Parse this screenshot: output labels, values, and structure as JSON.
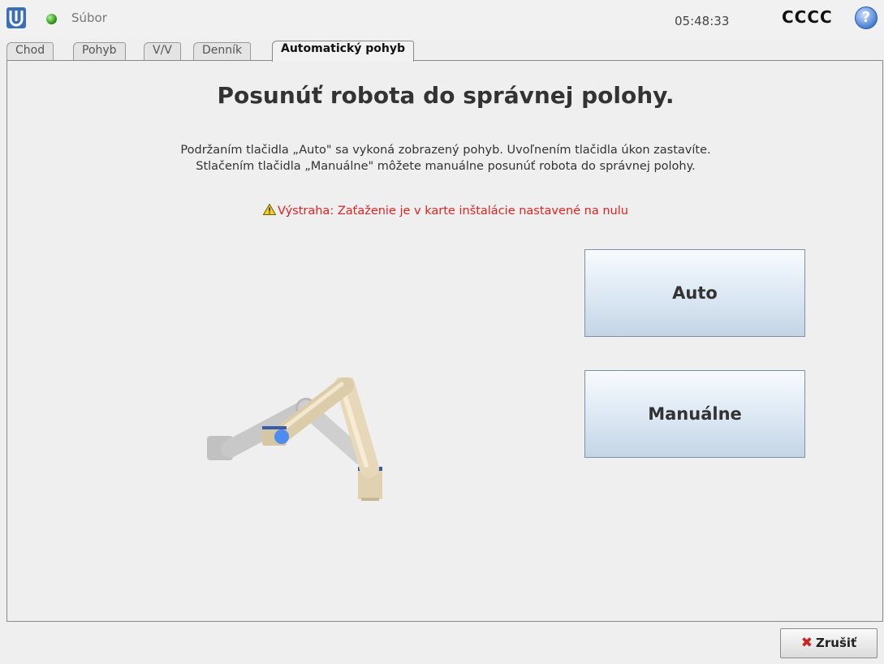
{
  "header": {
    "logo_icon": "ur-logo-icon",
    "status_icon": "robot-status-green-icon",
    "file_menu": "Súbor",
    "clock": "05:48:33",
    "robot_name": "CCCC",
    "help_label": "?"
  },
  "tabs": [
    {
      "label": "Chod"
    },
    {
      "label": "Pohyb"
    },
    {
      "label": "V/V"
    },
    {
      "label": "Denník"
    },
    {
      "label": "Automatický pohyb",
      "active": true
    }
  ],
  "main": {
    "title": "Posunúť robota do správnej polohy.",
    "instruction_1": "Podržaním tlačidla „Auto\" sa vykoná zobrazený pohyb. Uvoľnením tlačidla úkon zastavíte.",
    "instruction_2": "Stlačením tlačidla „Manuálne\" môžete manuálne posunúť robota do správnej polohy.",
    "warning": "Výstraha: Zaťaženie je v karte inštalácie nastavené na nulu",
    "warning_color": "#e42222",
    "auto_button": "Auto",
    "manual_button": "Manuálne"
  },
  "footer": {
    "cancel_label": "Zrušiť"
  }
}
